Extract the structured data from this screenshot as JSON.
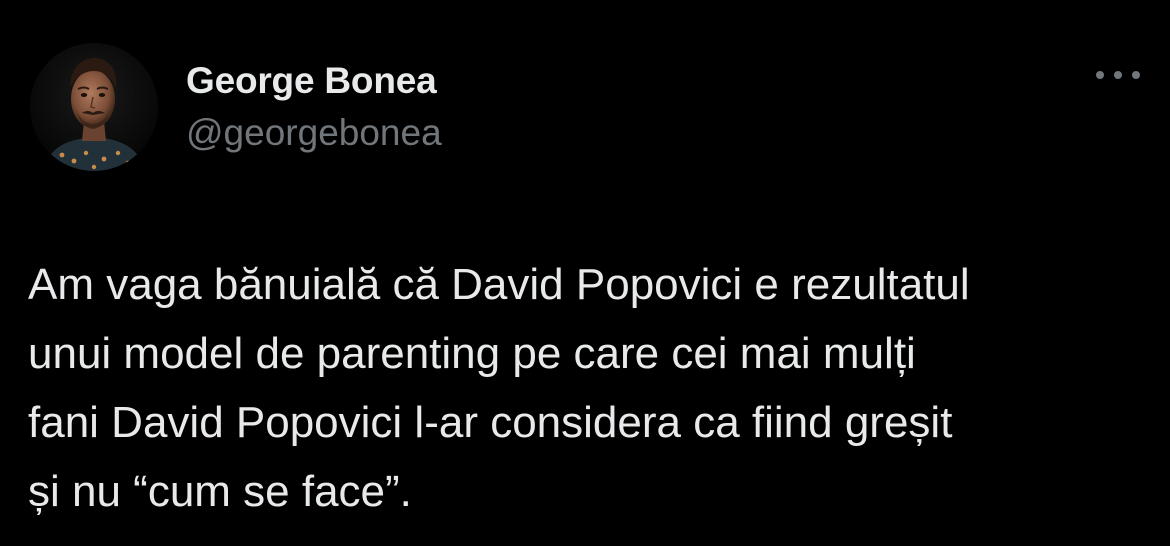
{
  "author": {
    "display_name": "George Bonea",
    "handle": "@georgebonea"
  },
  "tweet": {
    "text": "Am vaga bănuială că David Popovici e rezultatul\nunui model de parenting pe care cei mai mulți\nfani David Popovici l-ar considera ca fiind greșit\nși nu “cum se face”."
  },
  "icons": {
    "more": "more-horizontal-icon",
    "avatar": "profile-photo"
  },
  "colors": {
    "background": "#000000",
    "primary_text": "#e7e9ea",
    "secondary_text": "#71767b"
  }
}
